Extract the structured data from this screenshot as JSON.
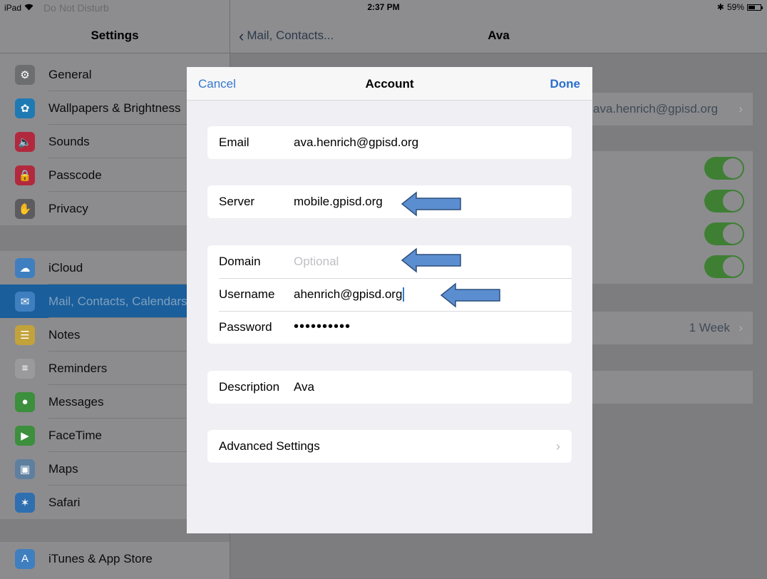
{
  "status_bar": {
    "device": "iPad",
    "wifi": "wifi-icon",
    "dnd_text": "Do Not Disturb",
    "time": "2:37 PM",
    "bluetooth": "bluetooth-icon",
    "battery": "59%",
    "battery_level": 0.59
  },
  "sidebar": {
    "title": "Settings",
    "group1": [
      {
        "label": "General",
        "icon": "gear-icon",
        "color": "#6d6e70"
      },
      {
        "label": "Wallpapers & Brightness",
        "icon": "flower-icon",
        "color": "#1f7ab3"
      },
      {
        "label": "Sounds",
        "icon": "speaker-icon",
        "color": "#b2293e"
      },
      {
        "label": "Passcode",
        "icon": "lock-icon",
        "color": "#b2293e"
      },
      {
        "label": "Privacy",
        "icon": "hand-icon",
        "color": "#5c5c60"
      }
    ],
    "group2": [
      {
        "label": "iCloud",
        "icon": "cloud-icon",
        "color": "#3f7fbf"
      },
      {
        "label": "Mail, Contacts, Calendars",
        "icon": "mail-icon",
        "color": "#3f7fbf",
        "selected": true
      },
      {
        "label": "Notes",
        "icon": "notes-icon",
        "color": "#c2a23a"
      },
      {
        "label": "Reminders",
        "icon": "reminders-icon",
        "color": "#9a9a9d"
      },
      {
        "label": "Messages",
        "icon": "messages-icon",
        "color": "#3c8f3c"
      },
      {
        "label": "FaceTime",
        "icon": "facetime-icon",
        "color": "#3c8f3c"
      },
      {
        "label": "Maps",
        "icon": "maps-icon",
        "color": "#5f7f9f"
      },
      {
        "label": "Safari",
        "icon": "safari-icon",
        "color": "#2f6fb0"
      }
    ],
    "group3": [
      {
        "label": "iTunes & App Store",
        "icon": "app-store-icon",
        "color": "#3f7fbf"
      }
    ]
  },
  "detail": {
    "back_label": "Mail, Contacts...",
    "title": "Ava",
    "email_value": "ava.henrich@gpisd.org",
    "sync_value": "1 Week"
  },
  "modal": {
    "cancel_label": "Cancel",
    "title": "Account",
    "done_label": "Done",
    "fields": {
      "email_label": "Email",
      "email_value": "ava.henrich@gpisd.org",
      "server_label": "Server",
      "server_value": "mobile.gpisd.org",
      "domain_label": "Domain",
      "domain_placeholder": "Optional",
      "username_label": "Username",
      "username_value": "ahenrich@gpisd.org",
      "password_label": "Password",
      "password_value": "••••••••••",
      "description_label": "Description",
      "description_value": "Ava",
      "advanced_label": "Advanced Settings"
    }
  },
  "colors": {
    "accent": "#3478cf",
    "toggle_on": "#3f7f34",
    "arrow_fill": "#5b8ed0",
    "arrow_stroke": "#2c4f7c"
  }
}
